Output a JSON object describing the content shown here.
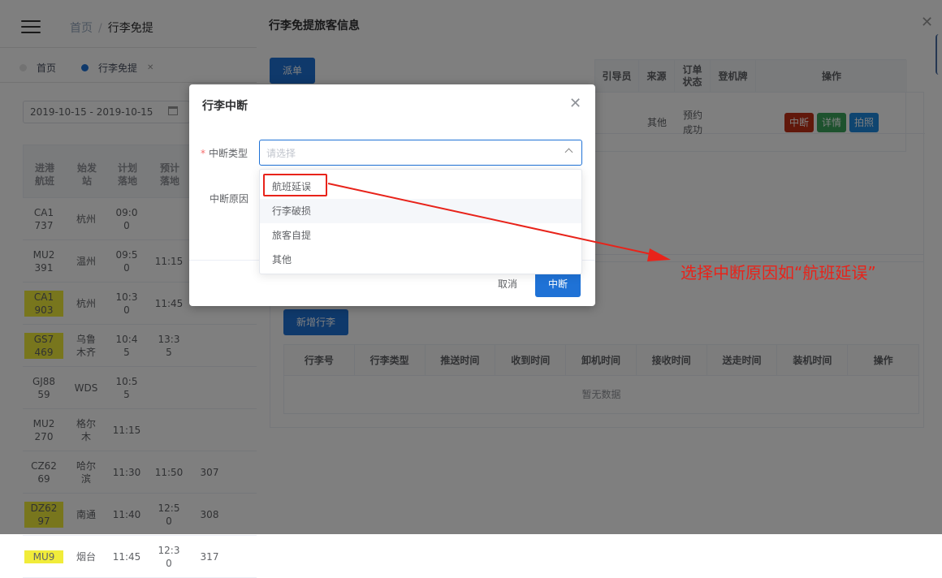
{
  "header": {
    "breadcrumb": [
      "首页",
      "行李免提"
    ]
  },
  "tags": {
    "home": "首页",
    "current": "行李免提"
  },
  "filters": {
    "date_range": "2019-10-15 - 2019-10-15"
  },
  "flight_table": {
    "headers": [
      [
        "进港",
        "航班"
      ],
      [
        "始发",
        "站"
      ],
      [
        "计划",
        "落地"
      ],
      [
        "预计",
        "落地"
      ]
    ],
    "rows": [
      {
        "flight": [
          "CA1",
          "737"
        ],
        "origin": [
          "杭州"
        ],
        "planned": [
          "09:0",
          "0"
        ],
        "est": [
          ""
        ],
        "gate": "",
        "extra": "",
        "hl": false
      },
      {
        "flight": [
          "MU2",
          "391"
        ],
        "origin": [
          "温州"
        ],
        "planned": [
          "09:5",
          "0"
        ],
        "est": [
          "11:15"
        ],
        "gate": "",
        "extra": "",
        "hl": false
      },
      {
        "flight": [
          "CA1",
          "903"
        ],
        "origin": [
          "杭州"
        ],
        "planned": [
          "10:3",
          "0"
        ],
        "est": [
          "11:45"
        ],
        "gate": "",
        "extra": "",
        "hl": true
      },
      {
        "flight": [
          "GS7",
          "469"
        ],
        "origin": [
          "乌鲁",
          "木齐"
        ],
        "planned": [
          "10:4",
          "5"
        ],
        "est": [
          "13:3",
          "5"
        ],
        "gate": "",
        "extra": "",
        "hl": true
      },
      {
        "flight": [
          "GJ88",
          "59"
        ],
        "origin": [
          "WDS"
        ],
        "planned": [
          "10:5",
          "5"
        ],
        "est": [
          ""
        ],
        "gate": "",
        "extra": "",
        "hl": false
      },
      {
        "flight": [
          "MU2",
          "270"
        ],
        "origin": [
          "格尔",
          "木"
        ],
        "planned": [
          "11:15"
        ],
        "est": [
          ""
        ],
        "gate": "",
        "extra": "",
        "hl": false
      },
      {
        "flight": [
          "CZ62",
          "69"
        ],
        "origin": [
          "哈尔",
          "滨"
        ],
        "planned": [
          "11:30"
        ],
        "est": [
          "11:50"
        ],
        "gate": "307",
        "extra": "",
        "hl": false
      },
      {
        "flight": [
          "DZ62",
          "97"
        ],
        "origin": [
          "南通"
        ],
        "planned": [
          "11:40"
        ],
        "est": [
          "12:5",
          "0"
        ],
        "gate": "308",
        "extra": "",
        "hl": true
      },
      {
        "flight": [
          "MU9",
          ""
        ],
        "origin": [
          "烟台"
        ],
        "planned": [
          "11:45"
        ],
        "est": [
          "12:3",
          "0"
        ],
        "gate": "317",
        "extra": "",
        "hl": true
      }
    ]
  },
  "drawer": {
    "title": "行李免提旅客信息",
    "dispatch_button": "派单",
    "passenger_table": {
      "headers": [
        "引导员",
        "来源",
        "订单状态",
        "登机牌",
        "操作"
      ],
      "row": {
        "guide": "",
        "source": "其他",
        "status": "预约成功",
        "boarding": ""
      },
      "actions": [
        "中断",
        "详情",
        "拍照"
      ]
    },
    "add_baggage_button": "新增行李",
    "baggage_table": {
      "headers": [
        "行李号",
        "行李类型",
        "推送时间",
        "收到时间",
        "卸机时间",
        "接收时间",
        "送走时间",
        "装机时间",
        "操作"
      ],
      "empty_text": "暂无数据"
    }
  },
  "dialog": {
    "title": "行李中断",
    "field_type_label": "中断类型",
    "field_reason_label": "中断原因",
    "select_placeholder": "请选择",
    "options": [
      "航班延误",
      "行李破损",
      "旅客自提",
      "其他"
    ],
    "cancel": "取消",
    "confirm": "中断"
  },
  "annotation": {
    "text": "选择中断原因如“航班延误”",
    "color": "#e8231a"
  }
}
